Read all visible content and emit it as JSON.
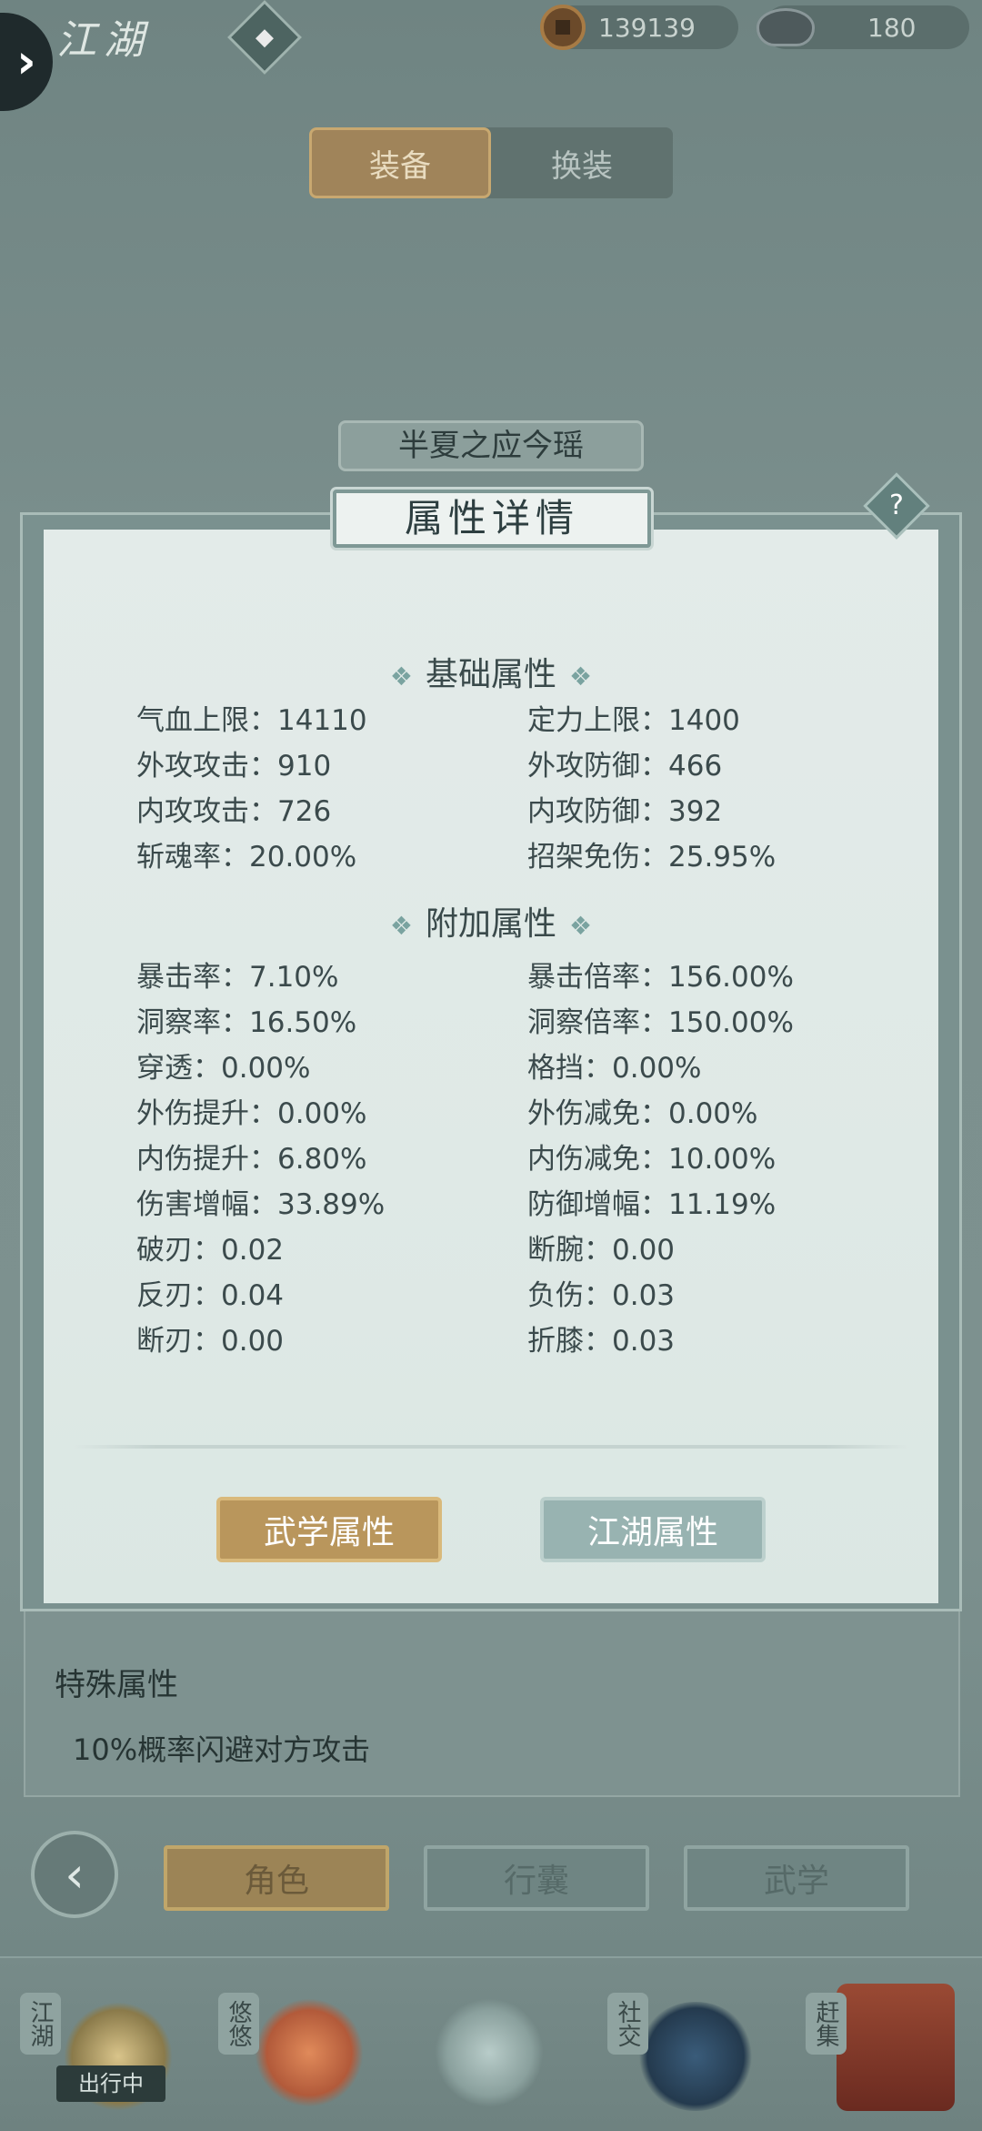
{
  "header": {
    "title": "江湖",
    "copper": "139139",
    "silver": "180"
  },
  "tabs": [
    "装备",
    "换装"
  ],
  "character_name": "半夏之应今瑶",
  "modal": {
    "title": "属性详情",
    "help": "?",
    "basic": {
      "title": "基础属性",
      "left": [
        "气血上限：14110",
        "外攻攻击：910",
        "内攻攻击：726",
        "斩魂率：20.00%"
      ],
      "right": [
        "定力上限：1400",
        "外攻防御：466",
        "内攻防御：392",
        "招架免伤：25.95%"
      ]
    },
    "extra": {
      "title": "附加属性",
      "left": [
        "暴击率：7.10%",
        "洞察率：16.50%",
        "穿透：0.00%",
        "外伤提升：0.00%",
        "内伤提升：6.80%",
        "伤害增幅：33.89%",
        "破刃：0.02",
        "反刃：0.04",
        "断刃：0.00"
      ],
      "right": [
        "暴击倍率：156.00%",
        "洞察倍率：150.00%",
        "格挡：0.00%",
        "外伤减免：0.00%",
        "内伤减免：10.00%",
        "防御增幅：11.19%",
        "断腕：0.00",
        "负伤：0.03",
        "折膝：0.03"
      ]
    },
    "buttons": {
      "martial": "武学属性",
      "jianghu": "江湖属性"
    }
  },
  "special": {
    "title": "特殊属性",
    "desc": "10%概率闪避对方攻击"
  },
  "nav": {
    "tabs": [
      "角色",
      "行囊",
      "武学"
    ]
  },
  "bottom": {
    "items": [
      "江湖",
      "悠悠",
      "社交",
      "赶集"
    ],
    "status": "出行中"
  }
}
